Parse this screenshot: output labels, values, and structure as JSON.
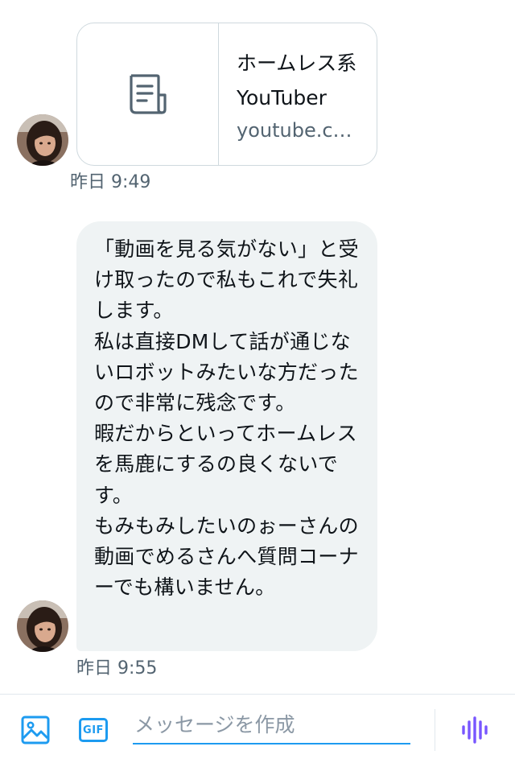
{
  "conversation": {
    "link_card": {
      "title": "ホームレス系YouTuber",
      "domain": "youtube.co...",
      "icon": "article-icon"
    },
    "link_timestamp": "昨日 9:49",
    "message": {
      "text": "「動画を見る気がない」と受け取ったので私もこれで失礼します。\n私は直接DMして話が通じないロボットみたいな方だったので非常に残念です。\n暇だからといってホームレスを馬鹿にするの良くないです。\nもみもみしたいのぉーさんの動画でめるさんへ質問コーナーでも構いません。"
    },
    "message_timestamp": "昨日 9:55"
  },
  "composer": {
    "image_button_icon": "image-icon",
    "gif_label": "GIF",
    "placeholder": "メッセージを作成",
    "value": "",
    "voice_button_icon": "voice-waveform-icon"
  },
  "colors": {
    "accent": "#1d9bf0",
    "bubble_bg": "#eff3f4",
    "muted_text": "#536471",
    "voice_icon": "#7856ff"
  }
}
